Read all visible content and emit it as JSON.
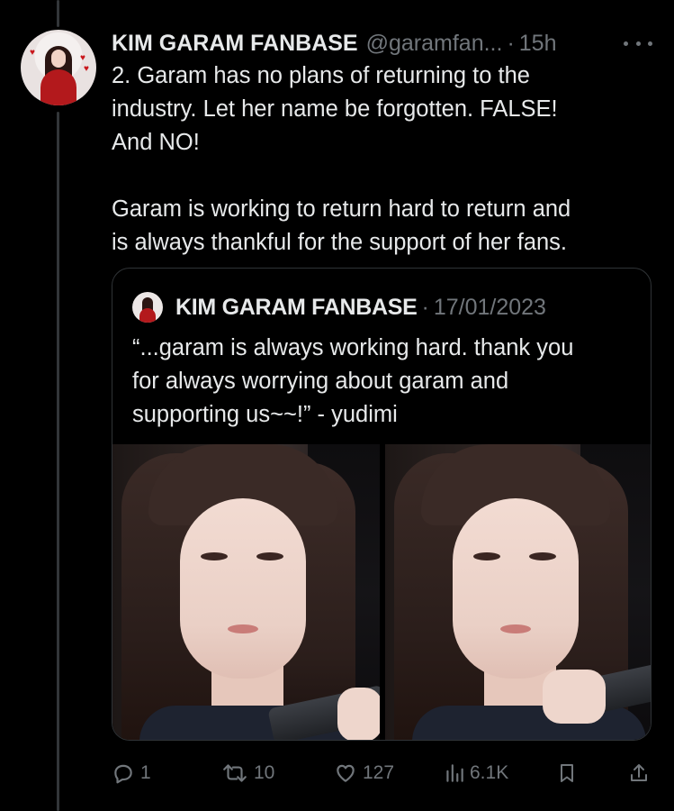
{
  "tweet": {
    "author_name": "KIM GARAM FANBASE",
    "author_handle": "@garamfan...",
    "separator": "·",
    "timestamp": "15h",
    "text_lines": [
      "2. Garam has no plans of returning to the",
      "industry. Let her name be forgotten. FALSE!",
      "And NO!"
    ],
    "text_lines_2": [
      "Garam is working to return hard to return and",
      "is always thankful for the support of her fans."
    ]
  },
  "quote": {
    "author_name": "KIM GARAM FANBASE",
    "separator": "·",
    "date": "17/01/2023",
    "text_lines": [
      "“...garam is always working hard. thank you",
      "for always worrying about garam and",
      "supporting us~~!” - yudimi"
    ]
  },
  "actions": {
    "replies": "1",
    "retweets": "10",
    "likes": "127",
    "views": "6.1K"
  },
  "icons": {
    "more": "more-horizontal-icon",
    "reply": "reply-icon",
    "retweet": "retweet-icon",
    "like": "heart-icon",
    "views": "views-icon",
    "bookmark": "bookmark-icon",
    "share": "share-icon"
  },
  "colors": {
    "background": "#000000",
    "text": "#e7e9ea",
    "muted": "#71767b",
    "border": "#2f3336"
  }
}
